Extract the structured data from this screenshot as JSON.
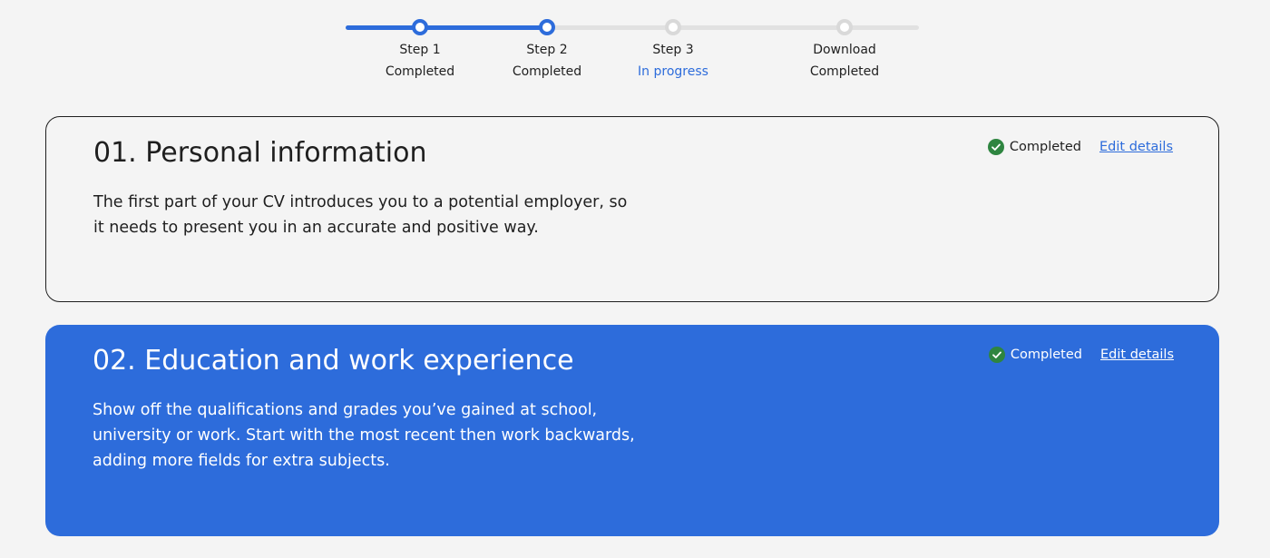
{
  "stepper": {
    "steps": [
      {
        "name": "Step 1",
        "status": "Completed"
      },
      {
        "name": "Step 2",
        "status": "Completed"
      },
      {
        "name": "Step 3",
        "status": "In progress"
      },
      {
        "name": "Download",
        "status": "Completed"
      }
    ],
    "accent_color": "#2d6cdb"
  },
  "sections": [
    {
      "title": "01. Personal information",
      "description": "The first part of your CV introduces you to a potential employer, so it needs to present you in an accurate and positive way.",
      "status": "Completed",
      "status_icon": "check-circle-icon",
      "edit_label": "Edit details"
    },
    {
      "title": "02. Education and work experience",
      "description": "Show off the qualifications and grades you’ve gained at school, university or work. Start with the most recent then work backwards, adding more fields for extra subjects.",
      "status": "Completed",
      "status_icon": "check-circle-icon",
      "edit_label": "Edit details"
    }
  ],
  "colors": {
    "primary": "#2d6cdb",
    "success": "#2e8540",
    "background": "#f4f4f4"
  }
}
